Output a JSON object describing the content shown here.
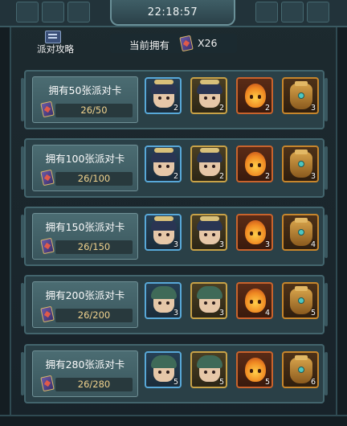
{
  "header": {
    "time": "22:18:57"
  },
  "guide": {
    "label": "派对攻略",
    "icon": "guide-book-icon"
  },
  "owned": {
    "label": "当前拥有",
    "count": "X26",
    "icon": "party-card-icon"
  },
  "tiers": [
    {
      "title": "拥有50张派对卡",
      "progress": "26/50",
      "rewards": [
        {
          "icon": "hero-portrait-icon",
          "qty": "2"
        },
        {
          "icon": "hero-portrait-icon",
          "qty": "2"
        },
        {
          "icon": "fire-spirit-icon",
          "qty": "2"
        },
        {
          "icon": "golden-urn-icon",
          "qty": "3"
        }
      ]
    },
    {
      "title": "拥有100张派对卡",
      "progress": "26/100",
      "rewards": [
        {
          "icon": "hero-portrait-icon",
          "qty": "2"
        },
        {
          "icon": "hero-portrait-icon",
          "qty": "2"
        },
        {
          "icon": "fire-spirit-icon",
          "qty": "2"
        },
        {
          "icon": "golden-urn-icon",
          "qty": "3"
        }
      ]
    },
    {
      "title": "拥有150张派对卡",
      "progress": "26/150",
      "rewards": [
        {
          "icon": "hero-portrait-icon",
          "qty": "3"
        },
        {
          "icon": "hero-portrait-icon",
          "qty": "3"
        },
        {
          "icon": "fire-spirit-icon",
          "qty": "3"
        },
        {
          "icon": "golden-urn-icon",
          "qty": "4"
        }
      ]
    },
    {
      "title": "拥有200张派对卡",
      "progress": "26/200",
      "rewards": [
        {
          "icon": "hero-portrait-icon",
          "qty": "3"
        },
        {
          "icon": "hero-portrait-icon",
          "qty": "3"
        },
        {
          "icon": "fire-spirit-icon",
          "qty": "4"
        },
        {
          "icon": "golden-urn-icon",
          "qty": "5"
        }
      ]
    },
    {
      "title": "拥有280张派对卡",
      "progress": "26/280",
      "rewards": [
        {
          "icon": "hero-portrait-icon",
          "qty": "5"
        },
        {
          "icon": "hero-portrait-icon",
          "qty": "5"
        },
        {
          "icon": "fire-spirit-icon",
          "qty": "5"
        },
        {
          "icon": "golden-urn-icon",
          "qty": "6"
        }
      ]
    }
  ],
  "colors": {
    "panel": "#2a4047",
    "accent_gold": "#f1d38e",
    "frame_blue": "#58a8d8",
    "frame_gold": "#c8a247"
  }
}
